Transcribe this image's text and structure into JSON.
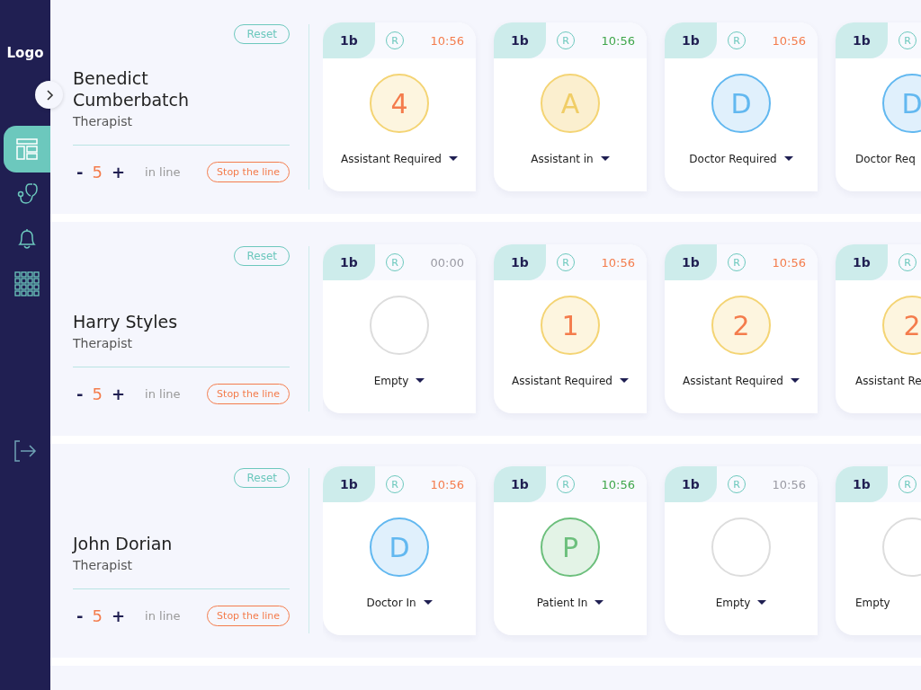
{
  "sidebar": {
    "logo": "Logo",
    "nav_items": [
      {
        "selected": true
      },
      {
        "selected": false
      },
      {
        "selected": false
      },
      {
        "selected": false
      }
    ]
  },
  "rows": [
    {
      "reset": "Reset",
      "name": "Benedict Cumberbatch",
      "role": "Therapist",
      "minus": "-",
      "count": "5",
      "plus": "+",
      "count_label": "in line",
      "stop": "Stop the line",
      "cards": [
        {
          "tag": "1b",
          "r": "R",
          "time": {
            "text": "10:56",
            "color": "#f47c4c"
          },
          "kind": "count",
          "symbol": "4",
          "status": "Assistant Required"
        },
        {
          "tag": "1b",
          "r": "R",
          "time": {
            "text": "10:56",
            "color": "#3fa64a"
          },
          "kind": "assistant",
          "symbol": "A",
          "status": "Assistant in"
        },
        {
          "tag": "1b",
          "r": "R",
          "time": {
            "text": "10:56",
            "color": "#f47c4c"
          },
          "kind": "doctor",
          "symbol": "D",
          "status": "Doctor Required"
        },
        {
          "tag": "1b",
          "r": "R",
          "kind": "doctor",
          "symbol": "D",
          "status": "Doctor Req"
        }
      ]
    },
    {
      "reset": "Reset",
      "name": "Harry Styles",
      "role": "Therapist",
      "minus": "-",
      "count": "5",
      "plus": "+",
      "count_label": "in line",
      "stop": "Stop the line",
      "cards": [
        {
          "tag": "1b",
          "r": "R",
          "time": {
            "text": "00:00",
            "color": "#9a9aa3"
          },
          "kind": "empty",
          "status": "Empty"
        },
        {
          "tag": "1b",
          "r": "R",
          "time": {
            "text": "10:56",
            "color": "#f47c4c"
          },
          "kind": "count",
          "symbol": "1",
          "status": "Assistant Required"
        },
        {
          "tag": "1b",
          "r": "R",
          "time": {
            "text": "10:56",
            "color": "#f47c4c"
          },
          "kind": "count",
          "symbol": "2",
          "status": "Assistant Required"
        },
        {
          "tag": "1b",
          "r": "R",
          "kind": "count",
          "symbol": "2",
          "status": "Assistant Re"
        }
      ]
    },
    {
      "reset": "Reset",
      "name": "John Dorian",
      "role": "Therapist",
      "minus": "-",
      "count": "5",
      "plus": "+",
      "count_label": "in line",
      "stop": "Stop the line",
      "cards": [
        {
          "tag": "1b",
          "r": "R",
          "time": {
            "text": "10:56",
            "color": "#f47c4c"
          },
          "kind": "doctor",
          "symbol": "D",
          "status": "Doctor In"
        },
        {
          "tag": "1b",
          "r": "R",
          "time": {
            "text": "10:56",
            "color": "#3fa64a"
          },
          "kind": "patient",
          "symbol": "P",
          "status": "Patient In"
        },
        {
          "tag": "1b",
          "r": "R",
          "time": {
            "text": "10:56",
            "color": "#9a9aa3"
          },
          "kind": "empty",
          "status": "Empty"
        },
        {
          "tag": "1b",
          "r": "R",
          "kind": "empty",
          "status": "Empty"
        }
      ]
    }
  ]
}
